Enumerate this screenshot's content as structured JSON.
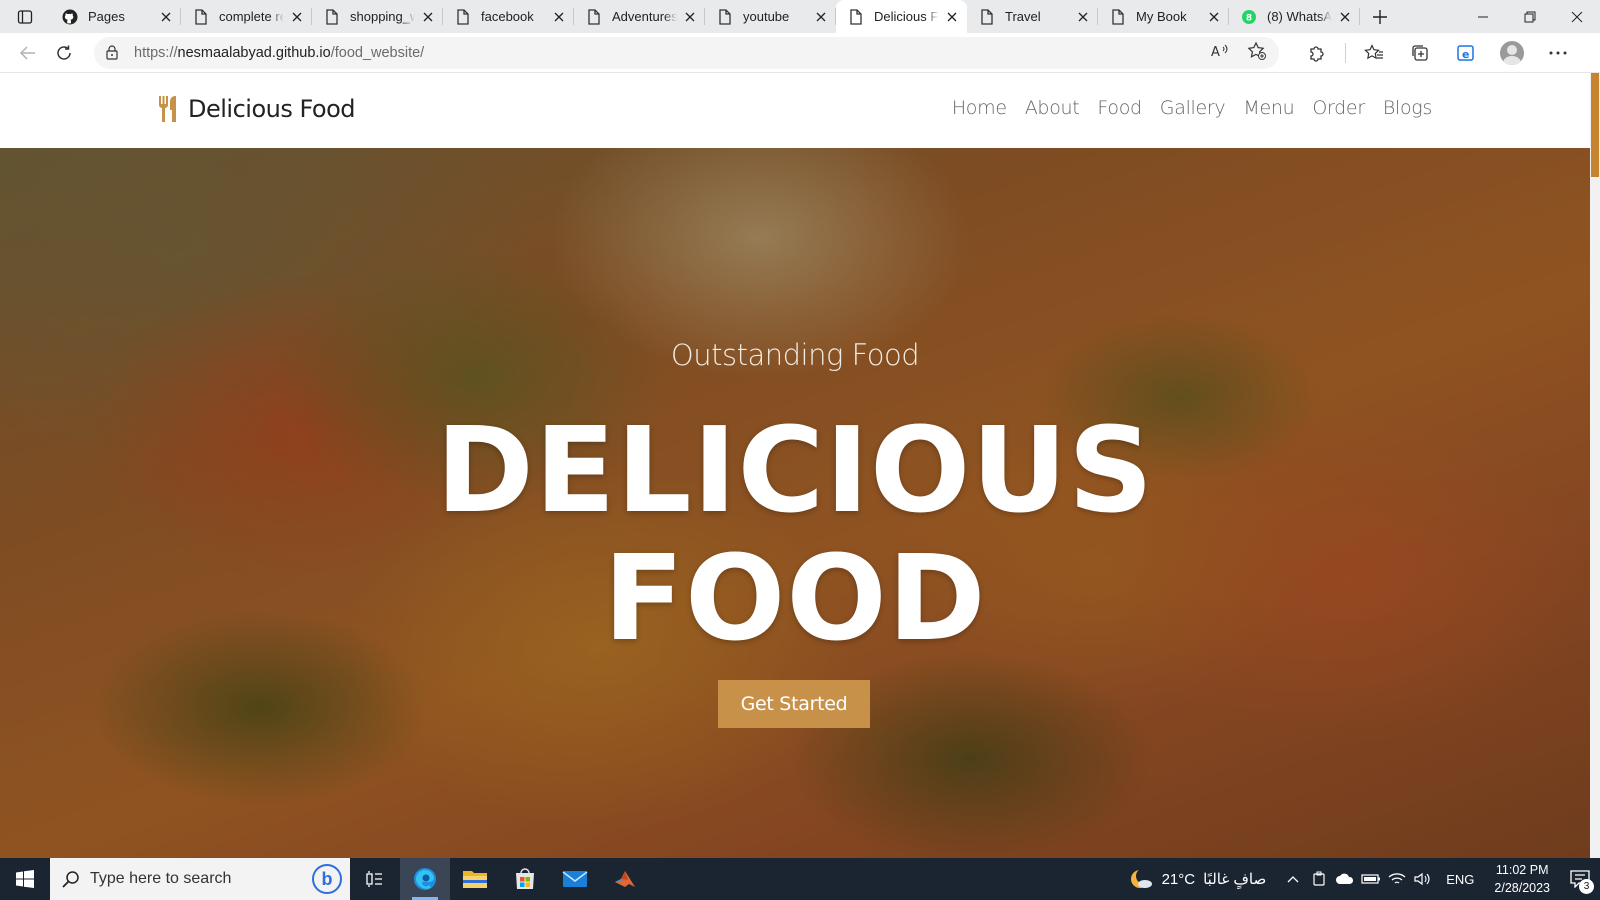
{
  "browser": {
    "tabs": [
      {
        "title": "Pages",
        "icon": "github-icon",
        "active": false
      },
      {
        "title": "complete re",
        "icon": "page-icon",
        "active": false
      },
      {
        "title": "shopping_w",
        "icon": "page-icon",
        "active": false
      },
      {
        "title": "facebook",
        "icon": "page-icon",
        "active": false
      },
      {
        "title": "Adventures",
        "icon": "page-icon",
        "active": false
      },
      {
        "title": "youtube",
        "icon": "page-icon",
        "active": false
      },
      {
        "title": "Delicious Fo",
        "icon": "page-icon",
        "active": true
      },
      {
        "title": "Travel",
        "icon": "page-icon",
        "active": false
      },
      {
        "title": "My Book",
        "icon": "page-icon",
        "active": false
      },
      {
        "title": "(8) WhatsAp",
        "icon": "whatsapp-icon",
        "active": false
      }
    ],
    "address": {
      "scheme": "https://",
      "host": "nesmaalabyad.github.io",
      "path": "/food_website/"
    }
  },
  "site": {
    "brand": "Delicious Food",
    "nav": [
      "Home",
      "About",
      "Food",
      "Gallery",
      "Menu",
      "Order",
      "Blogs"
    ],
    "hero": {
      "subtitle": "Outstanding Food",
      "title_line1": "DELICIOUS",
      "title_line2": "FOOD",
      "cta": "Get Started"
    },
    "colors": {
      "accent": "#c8914a",
      "scroll_thumb": "#c6842f"
    }
  },
  "taskbar": {
    "search_placeholder": "Type here to search",
    "weather_temp": "21°C",
    "weather_text": "صافٍ غالبًا",
    "language": "ENG",
    "time": "11:02 PM",
    "date": "2/28/2023",
    "notification_count": "3"
  }
}
